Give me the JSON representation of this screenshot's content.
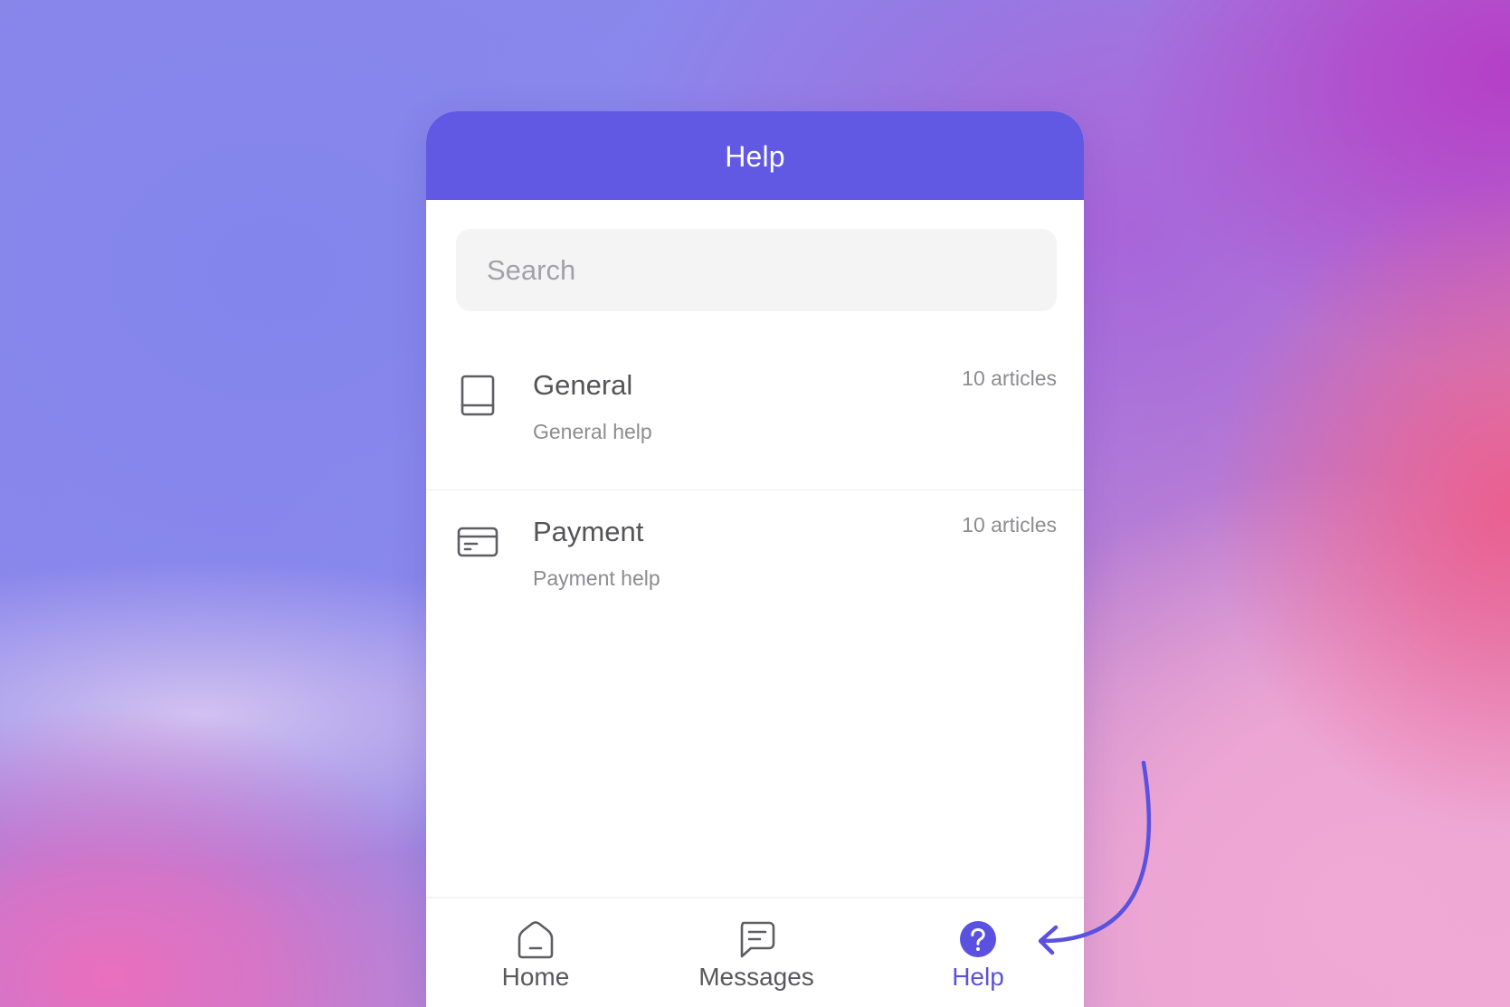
{
  "header": {
    "title": "Help"
  },
  "search": {
    "placeholder": "Search",
    "value": ""
  },
  "collections": [
    {
      "icon": "book-icon",
      "title": "General",
      "description": "General help",
      "count": "10 articles"
    },
    {
      "icon": "credit-card-icon",
      "title": "Payment",
      "description": "Payment help",
      "count": "10 articles"
    }
  ],
  "nav": {
    "items": [
      {
        "icon": "home-icon",
        "label": "Home",
        "active": false
      },
      {
        "icon": "message-icon",
        "label": "Messages",
        "active": false
      },
      {
        "icon": "help-circle-icon",
        "label": "Help",
        "active": true
      }
    ]
  },
  "colors": {
    "accent": "#6159e4",
    "active_nav": "#5b51e0",
    "text_primary": "#545459",
    "text_secondary": "#8c8c92",
    "search_bg": "#f4f4f5"
  }
}
